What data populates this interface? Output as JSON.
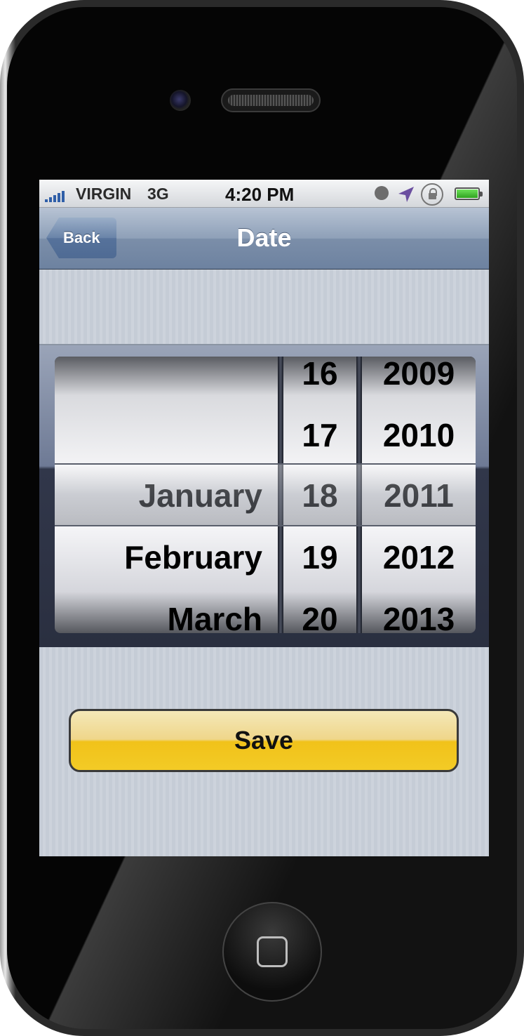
{
  "status_bar": {
    "carrier": "VIRGIN",
    "network": "3G",
    "time": "4:20 PM"
  },
  "nav": {
    "title": "Date",
    "back_label": "Back"
  },
  "picker": {
    "months": [
      "",
      "",
      "January",
      "February",
      "March"
    ],
    "days": [
      "16",
      "17",
      "18",
      "19",
      "20"
    ],
    "years": [
      "2009",
      "2010",
      "2011",
      "2012",
      "2013"
    ],
    "selected": {
      "month": "January",
      "day": "18",
      "year": "2011"
    }
  },
  "save_label": "Save",
  "colors": {
    "nav_bar": "#7b8ea9",
    "save_button": "#f1c21a",
    "screen_background": "#c5ccd6"
  }
}
